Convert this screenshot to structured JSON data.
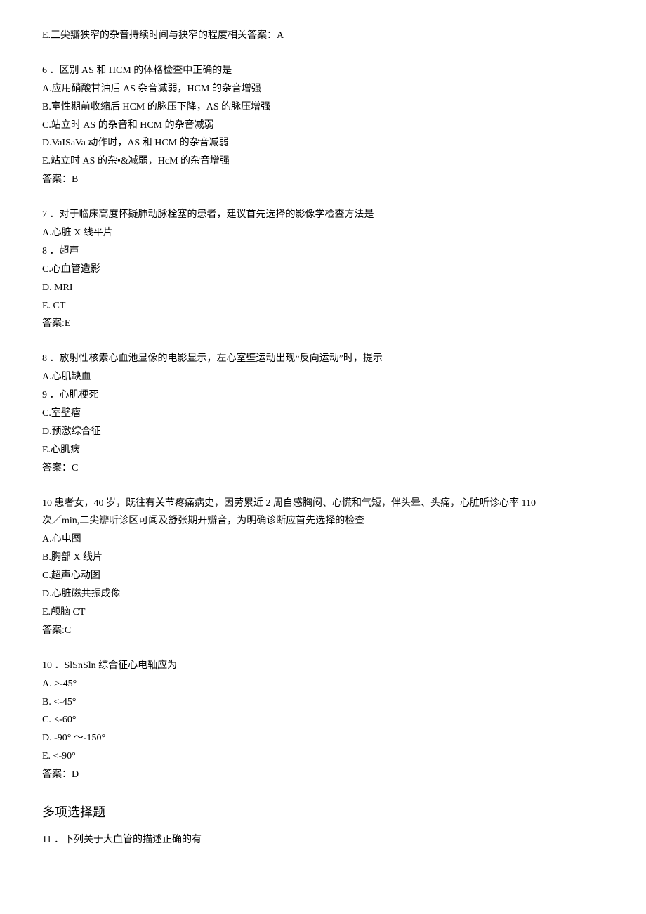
{
  "q5": {
    "optionE": "E.三尖瓣狭窄的杂音持续时间与狭窄的程度相关答案：A"
  },
  "q6": {
    "stem": "6 ．区别 AS 和 HCM 的体格检查中正确的是",
    "a": "A.应用硝酸甘油后 AS 杂音减弱，HCM 的杂音增强",
    "b": "B.室性期前收缩后 HCM 的脉压下降，AS 的脉压增强",
    "c": "C.站立时 AS 的杂音和 HCM 的杂音减弱",
    "d": "D.VaISaVa 动作时，AS 和 HCM 的杂音减弱",
    "e": "E.站立时 AS 的杂•&减弱，HcM 的杂音增强",
    "ans": "答案：B"
  },
  "q7": {
    "stem": "7 ．对于临床高度怀疑肺动脉栓塞的患者，建议首先选择的影像学检查方法是",
    "a": "A.心脏 X 线平片",
    "b": "8 ．超声",
    "c": "C.心血管造影",
    "d": "D.  MRI",
    "e": "E.  CT",
    "ans": "答案:E"
  },
  "q8": {
    "stem": "8 ．放射性核素心血池显像的电影显示，左心室壁运动出现“反向运动”时，提示",
    "a": "A.心肌缺血",
    "b": "9 ．心肌梗死",
    "c": "C.室壁瘤",
    "d": "D.预激综合征",
    "e": "E.心肌病",
    "ans": "答案：C"
  },
  "q9": {
    "stem1": "10  患者女，40 岁，既往有关节疼痛病史，因劳累近 2 周自感胸闷、心慌和气短，伴头晕、头痛，心脏听诊心率 110",
    "stem2": "次／min,二尖瓣听诊区可闻及舒张期开瓣音，为明确诊断应首先选择的检查",
    "a": "A.心电图",
    "b": "B.胸部 X 线片",
    "c": "C.超声心动图",
    "d": "D.心脏磁共振成像",
    "e": "E.颅脑 CT",
    "ans": "答案:C"
  },
  "q10": {
    "stem": "10 ．SlSnSln 综合征心电轴应为",
    "a": "A.  >-45°",
    "b": "B.  <-45°",
    "c": "C.  <-60°",
    "d": "D.  -90° ～-150°",
    "e": "E.  <-90°",
    "ans": "答案：D"
  },
  "section": {
    "title": "多项选择题"
  },
  "q11": {
    "stem": "11 ．下列关于大血管的描述正确的有"
  }
}
